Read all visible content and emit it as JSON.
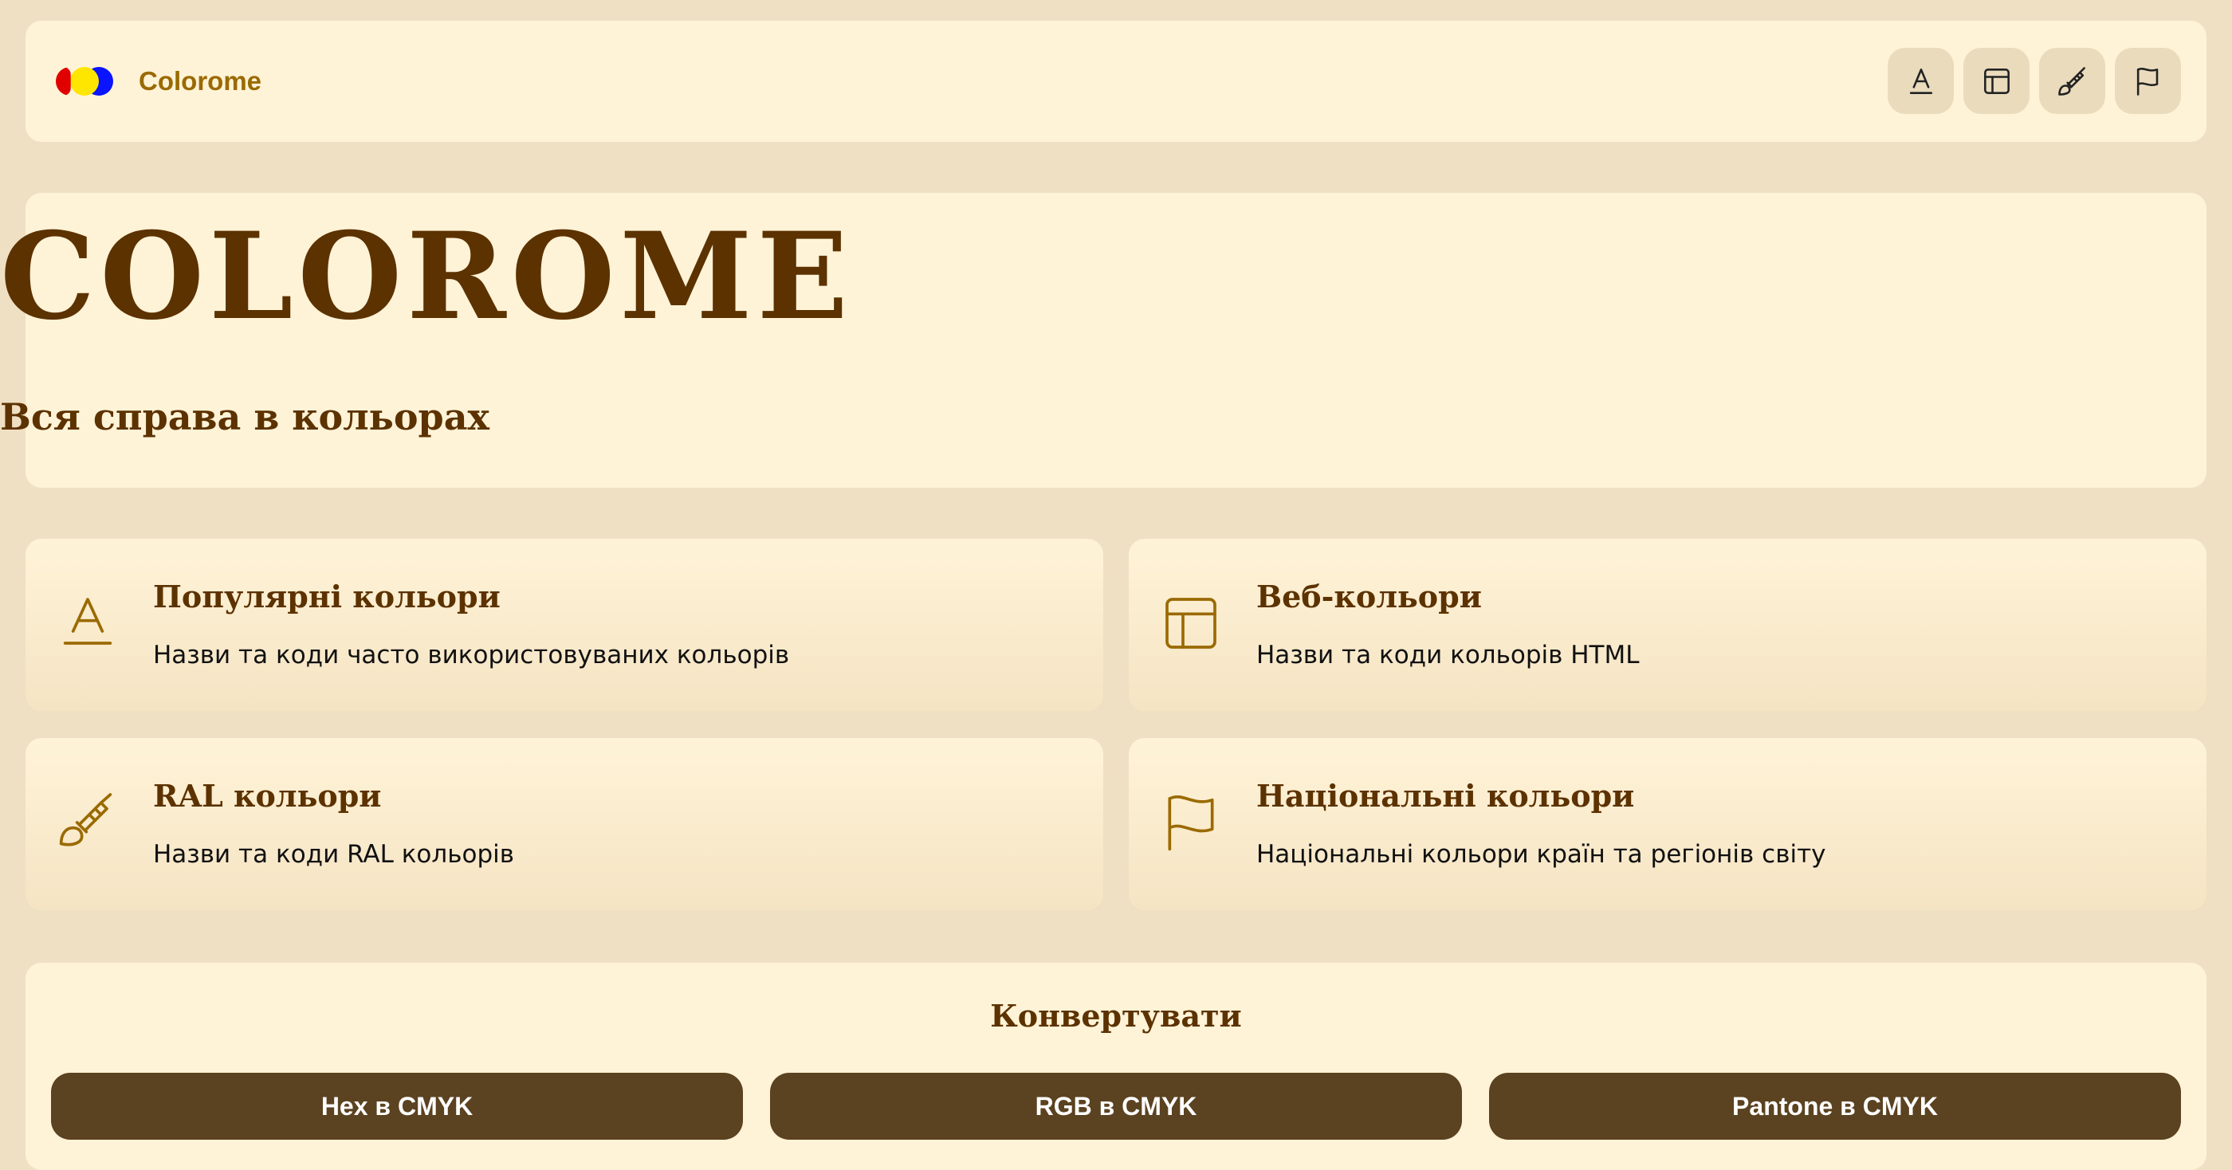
{
  "header": {
    "brand": "Colorome",
    "logo_colors": [
      "#e00000",
      "#ffe600",
      "#0a14ff"
    ],
    "nav": [
      {
        "icon": "letter-a-icon"
      },
      {
        "icon": "layout-icon"
      },
      {
        "icon": "brush-icon"
      },
      {
        "icon": "flag-icon"
      }
    ]
  },
  "hero": {
    "title": "COLOROME",
    "subtitle": "Вся справа в кольорах"
  },
  "features": [
    {
      "icon": "letter-a-icon",
      "title": "Популярні кольори",
      "description": "Назви та коди часто використовуваних кольорів"
    },
    {
      "icon": "layout-icon",
      "title": "Веб-кольори",
      "description": "Назви та коди кольорів HTML"
    },
    {
      "icon": "brush-icon",
      "title": "RAL кольори",
      "description": "Назви та коди RAL кольорів"
    },
    {
      "icon": "flag-icon",
      "title": "Національні кольори",
      "description": "Національні кольори країн та регіонів світу"
    }
  ],
  "convert": {
    "title": "Конвертувати",
    "buttons": [
      "Hex в CMYK",
      "RGB в CMYK",
      "Pantone в CMYK"
    ]
  },
  "colors": {
    "page_bg": "#f0e0c3",
    "card_bg": "#fff3d7",
    "heading": "#5c3200",
    "accent": "#9a6a00",
    "button": "#5b4220"
  }
}
